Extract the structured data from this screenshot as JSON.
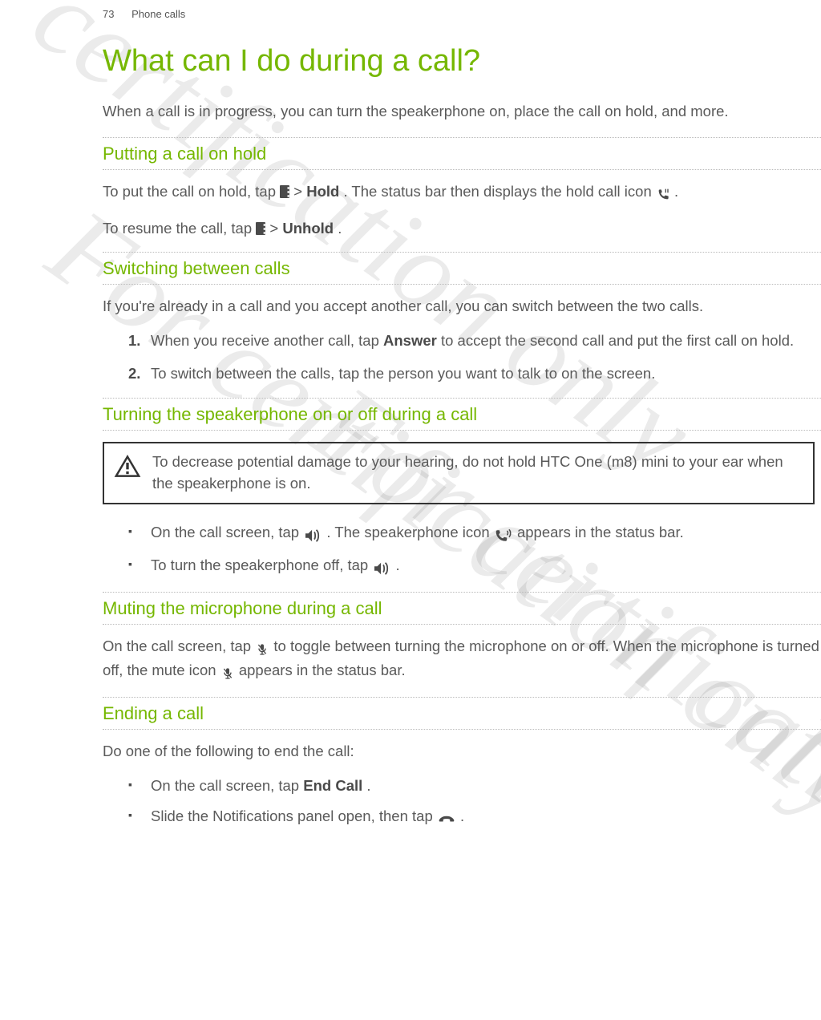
{
  "header": {
    "page_number": "73",
    "section": "Phone calls"
  },
  "title": "What can I do during a call?",
  "intro": "When a call is in progress, you can turn the speakerphone on, place the call on hold, and more.",
  "hold": {
    "heading": "Putting a call on hold",
    "p1a": "To put the call on hold, tap ",
    "p1b": " > ",
    "p1c": "Hold",
    "p1d": ". The status bar then displays the hold call icon ",
    "p1e": ".",
    "p2a": "To resume the call, tap ",
    "p2b": " > ",
    "p2c": "Unhold",
    "p2d": "."
  },
  "switch": {
    "heading": "Switching between calls",
    "intro": "If you're already in a call and you accept another call, you can switch between the two calls.",
    "step1a": "When you receive another call, tap ",
    "step1b": "Answer",
    "step1c": " to accept the second call and put the first call on hold.",
    "step2": "To switch between the calls, tap the person you want to talk to on the screen.",
    "num1": "1.",
    "num2": "2."
  },
  "speaker": {
    "heading": "Turning the speakerphone on or off during a call",
    "warning": "To decrease potential damage to your hearing, do not hold HTC One (m8) mini to your ear when the speakerphone is on.",
    "b1a": "On the call screen, tap ",
    "b1b": ". The speakerphone icon ",
    "b1c": " appears in the status bar.",
    "b2a": "To turn the speakerphone off, tap ",
    "b2b": "."
  },
  "mute": {
    "heading": "Muting the microphone during a call",
    "p1a": "On the call screen, tap ",
    "p1b": " to toggle between turning the microphone on or off. When the microphone is turned off, the mute icon ",
    "p1c": " appears in the status bar."
  },
  "end": {
    "heading": "Ending a call",
    "intro": "Do one of the following to end the call:",
    "b1a": "On the call screen, tap ",
    "b1b": "End Call",
    "b1c": ".",
    "b2a": "Slide the Notifications panel open, then tap ",
    "b2b": "."
  },
  "watermark": "For certification only"
}
